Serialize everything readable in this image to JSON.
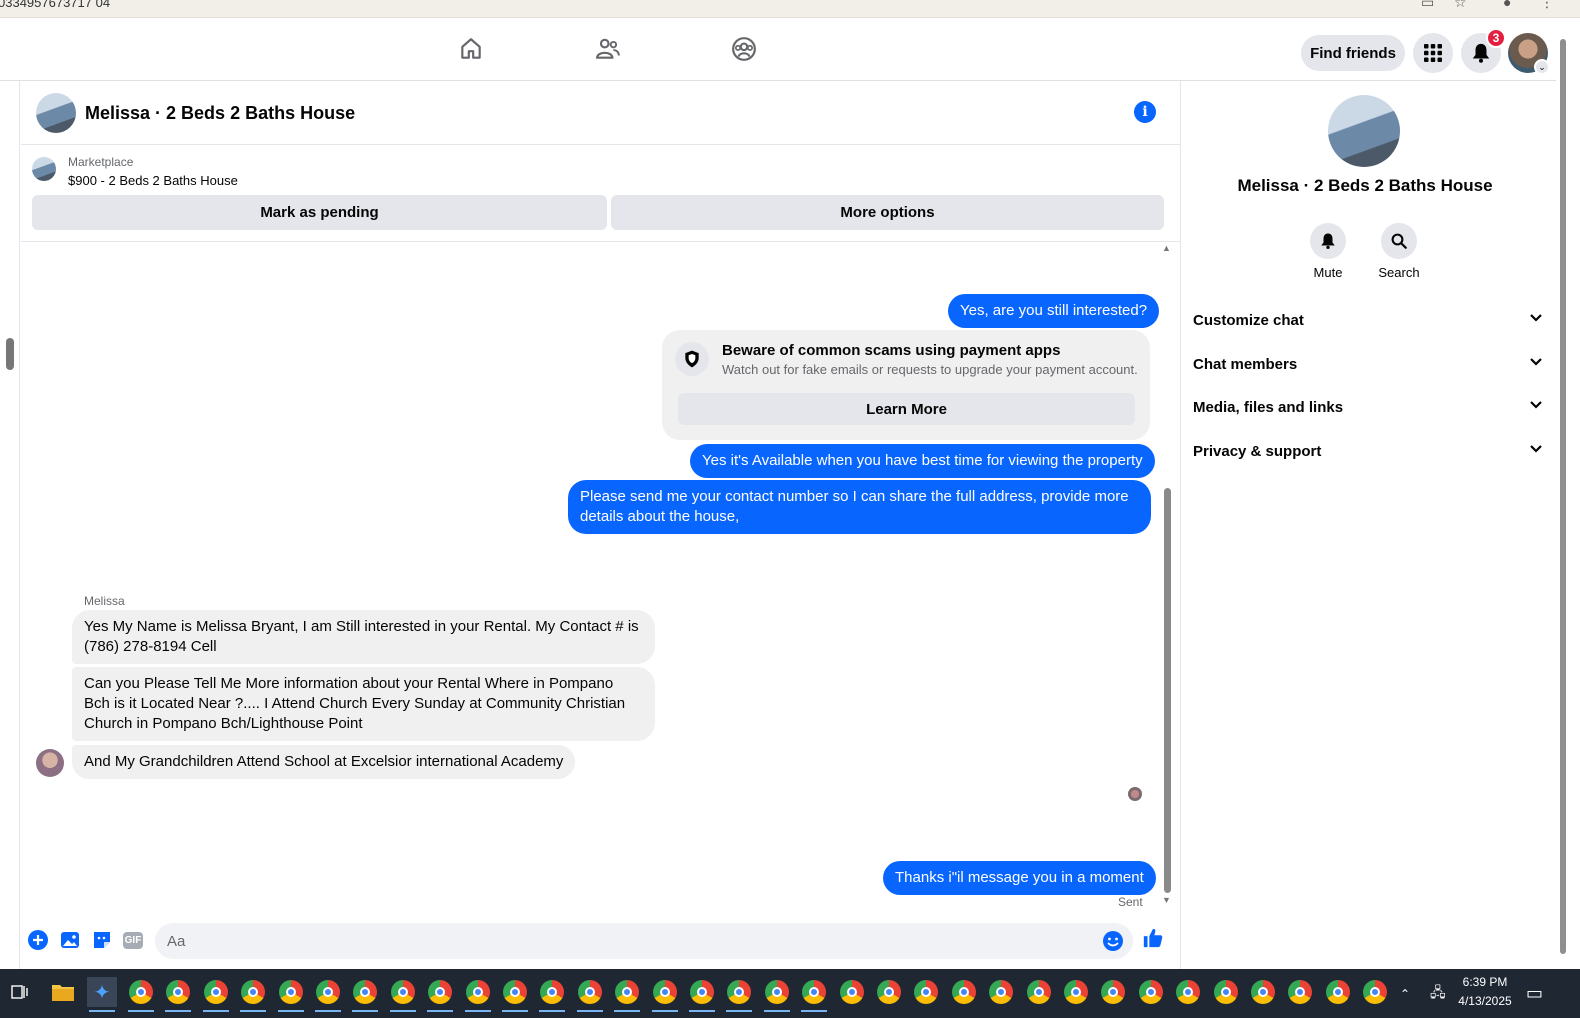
{
  "browser": {
    "url_fragment": "0334957673717 04"
  },
  "topnav": {
    "find_friends": "Find friends",
    "notification_count": "3"
  },
  "chat": {
    "title": "Melissa · 2 Beds 2 Baths House",
    "info_icon": "i",
    "marketplace": {
      "label": "Marketplace",
      "listing": "$900 - 2 Beds 2 Baths House",
      "mark_pending": "Mark as pending",
      "more_options": "More options"
    },
    "messages": [
      {
        "dir": "out",
        "text": "Yes, are you still interested?"
      },
      {
        "dir": "out",
        "text": "Yes it's Available when you have best time for viewing the property"
      },
      {
        "dir": "out",
        "text": "Please send me your contact number so I can share the full address, provide more details about the house,"
      },
      {
        "dir": "in",
        "text": "Yes My Name is Melissa Bryant, I am Still interested in your Rental. My Contact # is (786) 278-8194 Cell"
      },
      {
        "dir": "in",
        "text": "Can you Please Tell Me More information about your Rental Where in Pompano Bch is it Located Near ?.... I Attend Church Every Sunday at Community Christian Church in Pompano Bch/Lighthouse Point"
      },
      {
        "dir": "in",
        "text": "And My Grandchildren Attend School at Excelsior international Academy"
      },
      {
        "dir": "out",
        "text": "Thanks i\"il message you in a moment"
      }
    ],
    "scam_notice": {
      "title": "Beware of common scams using payment apps",
      "subtitle": "Watch out for fake emails or requests to upgrade your payment account.",
      "button": "Learn More"
    },
    "sender_name": "Melissa",
    "status": "Sent",
    "composer": {
      "placeholder": "Aa",
      "gif_label": "GIF"
    }
  },
  "panel": {
    "name": "Melissa · 2 Beds 2 Baths House",
    "mute": "Mute",
    "search": "Search",
    "sections": [
      "Customize chat",
      "Chat members",
      "Media, files and links",
      "Privacy & support"
    ]
  },
  "taskbar": {
    "time": "6:39 PM",
    "date": "4/13/2025"
  },
  "colors": {
    "accent": "#0866ff",
    "bubble_in": "#f0f0f0",
    "taskbar": "#1f2733"
  }
}
